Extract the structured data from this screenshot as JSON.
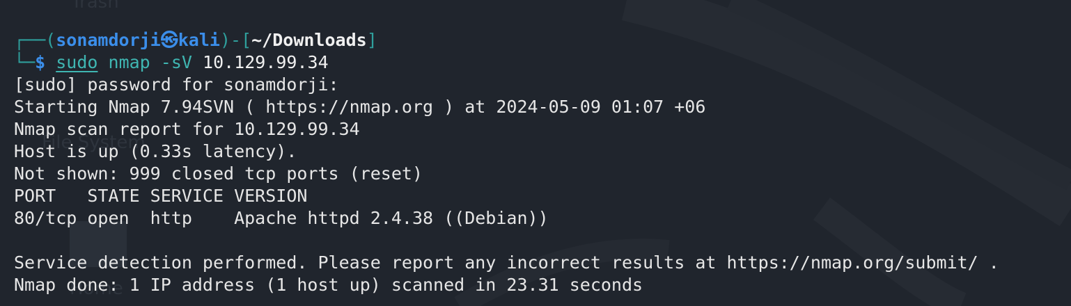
{
  "prompt": {
    "user_host_user": "sonamdorji",
    "at_symbol": "㉿",
    "host": "kali",
    "path": "~/Downloads",
    "dollar": "$",
    "command": "sudo",
    "arg1": "nmap",
    "arg2": "-sV",
    "target": "10.129.99.34"
  },
  "output": [
    "[sudo] password for sonamdorji:",
    "Starting Nmap 7.94SVN ( https://nmap.org ) at 2024-05-09 01:07 +06",
    "Nmap scan report for 10.129.99.34",
    "Host is up (0.33s latency).",
    "Not shown: 999 closed tcp ports (reset)",
    "PORT   STATE SERVICE VERSION",
    "80/tcp open  http    Apache httpd 2.4.38 ((Debian))",
    "",
    "Service detection performed. Please report any incorrect results at https://nmap.org/submit/ .",
    "Nmap done: 1 IP address (1 host up) scanned in 23.31 seconds"
  ],
  "background": {
    "ghost_labels": [
      "Trash",
      "File System",
      "Home"
    ]
  },
  "colors": {
    "background": "#20252d",
    "prompt_user": "#3b8eea",
    "command": "#3fb6b2",
    "text": "#e6e6e6"
  }
}
